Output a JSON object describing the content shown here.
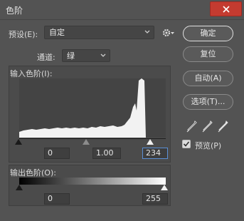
{
  "window": {
    "title": "色阶"
  },
  "preset": {
    "label": "预设(E):",
    "value": "自定"
  },
  "channel": {
    "label": "通道:",
    "value": "绿"
  },
  "input_levels": {
    "label": "输入色阶(I):",
    "black": "0",
    "gamma": "1.00",
    "white": "234"
  },
  "output_levels": {
    "label": "输出色阶(O):",
    "black": "0",
    "white": "255"
  },
  "buttons": {
    "ok": "确定",
    "reset": "复位",
    "auto": "自动(A)",
    "options": "选项(T)..."
  },
  "preview": {
    "label": "预览(P)",
    "checked": true
  },
  "colors": {
    "close_red": "#c43b30",
    "active_field_border": "#5b8fd6"
  }
}
